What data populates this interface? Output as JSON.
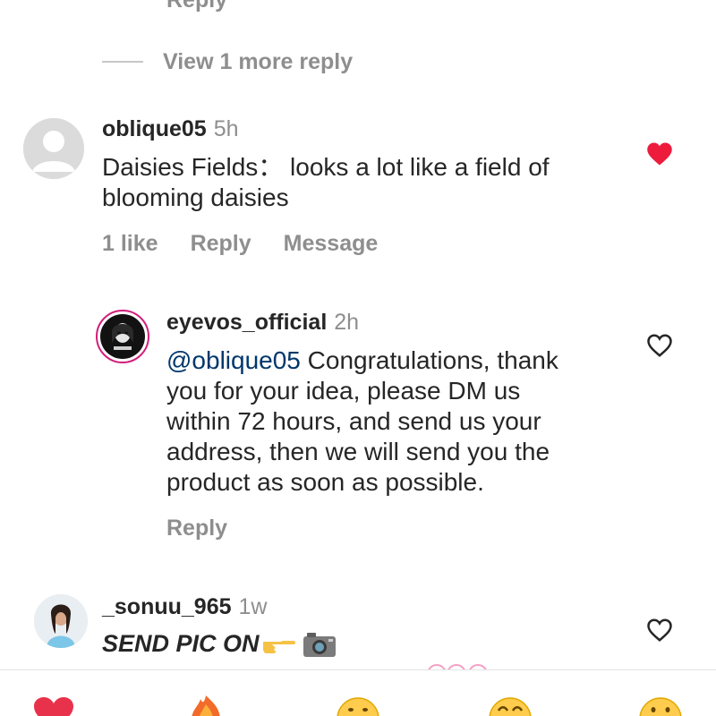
{
  "top_partial_text": "Reply",
  "view_more": "View 1 more reply",
  "comments": [
    {
      "username": "oblique05",
      "time": "5h",
      "text_lines": [
        "Daisies Fields： looks a lot like a field of",
        "blooming daisies"
      ],
      "likes": "1 like",
      "reply": "Reply",
      "message": "Message",
      "liked": true
    },
    {
      "username": "eyevos_official",
      "time": "2h",
      "mention": "@oblique05",
      "text_first": " Congratulations, thank",
      "text_lines": [
        "you for your idea, please DM us",
        "within 72 hours, and send us your",
        "address, then we will send you the",
        "product as soon as possible."
      ],
      "reply": "Reply",
      "liked": false
    },
    {
      "username": "_sonuu_965",
      "time": "1w",
      "text": "SEND PIC ON",
      "liked": false
    }
  ],
  "emoji_bar": [
    "heart-emoji",
    "fire-emoji",
    "smile-emoji",
    "laugh-emoji",
    "grin-emoji"
  ],
  "colors": {
    "liked_heart": "#ed1c3d",
    "muted_text": "#8e8e8e",
    "mention": "#00376b",
    "story_ring": "#d11f7c"
  }
}
